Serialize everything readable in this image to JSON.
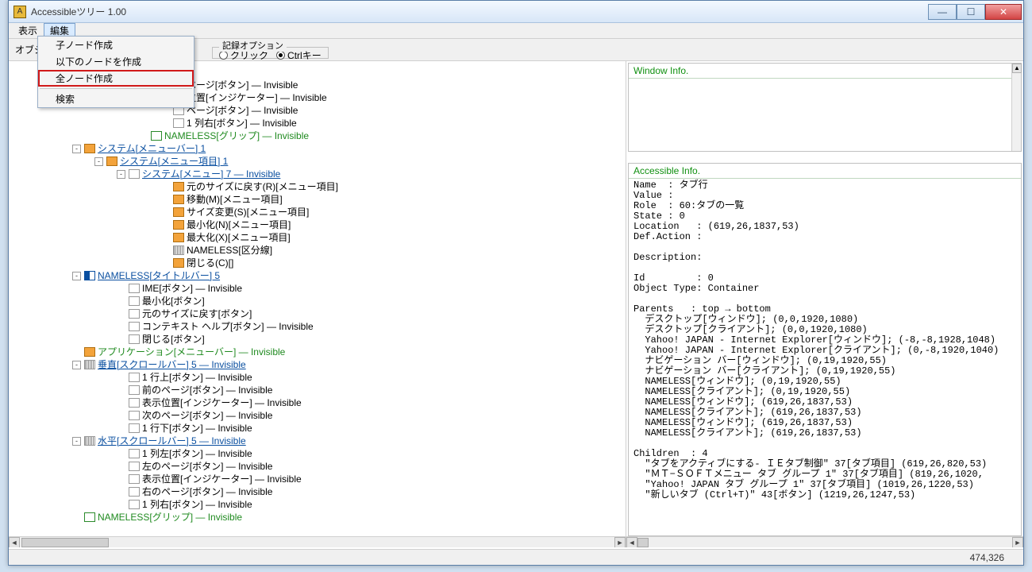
{
  "title": "Accessibleツリー 1.00",
  "menubar": {
    "view": "表示",
    "edit": "編集"
  },
  "toolbar": {
    "obj_label_prefix": "オブジ",
    "legend": "記録オプション",
    "radio_click": "クリック",
    "radio_ctrl": "Ctrlキー"
  },
  "dropdown": {
    "item_child": "子ノード作成",
    "item_below": "以下のノードを作成",
    "item_all": "全ノード作成",
    "item_search": "検索"
  },
  "tree": [
    {
      "d": 13,
      "i": "box",
      "t": "ページ[ボタン] — Invisible",
      "cls": ""
    },
    {
      "d": 13,
      "i": "box",
      "t": "位置[インジケーター] — Invisible",
      "cls": ""
    },
    {
      "d": 13,
      "i": "box",
      "t": "ページ[ボタン] — Invisible",
      "cls": ""
    },
    {
      "d": 13,
      "i": "box",
      "t": "1 列右[ボタン] — Invisible",
      "cls": ""
    },
    {
      "d": 11,
      "i": "green",
      "t": "NAMELESS[グリップ] — Invisible",
      "cls": "lbl-green"
    },
    {
      "d": 5,
      "exp": "-",
      "i": "orange",
      "t": "システム[メニューバー] 1",
      "cls": "lbl-link"
    },
    {
      "d": 7,
      "exp": "-",
      "i": "orange",
      "t": "システム[メニュー項目] 1",
      "cls": "lbl-link"
    },
    {
      "d": 9,
      "exp": "-",
      "i": "",
      "t": "システム[メニュー] 7 — Invisible",
      "cls": "lbl-link"
    },
    {
      "d": 13,
      "i": "orange",
      "t": "元のサイズに戻す(R)[メニュー項目]",
      "cls": ""
    },
    {
      "d": 13,
      "i": "orange",
      "t": "移動(M)[メニュー項目]",
      "cls": ""
    },
    {
      "d": 13,
      "i": "orange",
      "t": "サイズ変更(S)[メニュー項目]",
      "cls": ""
    },
    {
      "d": 13,
      "i": "orange",
      "t": "最小化(N)[メニュー項目]",
      "cls": ""
    },
    {
      "d": 13,
      "i": "orange",
      "t": "最大化(X)[メニュー項目]",
      "cls": ""
    },
    {
      "d": 13,
      "i": "bar",
      "t": "NAMELESS[区分線]",
      "cls": ""
    },
    {
      "d": 13,
      "i": "orange",
      "t": "閉じる(C)[]",
      "cls": ""
    },
    {
      "d": 5,
      "exp": "-",
      "i": "flag",
      "t": "NAMELESS[タイトルバー] 5",
      "cls": "lbl-link"
    },
    {
      "d": 9,
      "i": "box",
      "t": "IME[ボタン] — Invisible",
      "cls": ""
    },
    {
      "d": 9,
      "i": "box",
      "t": "最小化[ボタン]",
      "cls": ""
    },
    {
      "d": 9,
      "i": "box",
      "t": "元のサイズに戻す[ボタン]",
      "cls": ""
    },
    {
      "d": 9,
      "i": "box",
      "t": "コンテキスト ヘルプ[ボタン] — Invisible",
      "cls": ""
    },
    {
      "d": 9,
      "i": "box",
      "t": "閉じる[ボタン]",
      "cls": ""
    },
    {
      "d": 5,
      "i": "orange",
      "t": "アプリケーション[メニューバー] — Invisible",
      "cls": "lbl-green"
    },
    {
      "d": 5,
      "exp": "-",
      "i": "bar",
      "t": "垂直[スクロールバー] 5 — Invisible",
      "cls": "lbl-link"
    },
    {
      "d": 9,
      "i": "box",
      "t": "1 行上[ボタン] — Invisible",
      "cls": ""
    },
    {
      "d": 9,
      "i": "box",
      "t": "前のページ[ボタン] — Invisible",
      "cls": ""
    },
    {
      "d": 9,
      "i": "box",
      "t": "表示位置[インジケーター] — Invisible",
      "cls": ""
    },
    {
      "d": 9,
      "i": "box",
      "t": "次のページ[ボタン] — Invisible",
      "cls": ""
    },
    {
      "d": 9,
      "i": "box",
      "t": "1 行下[ボタン] — Invisible",
      "cls": ""
    },
    {
      "d": 5,
      "exp": "-",
      "i": "bar",
      "t": "水平[スクロールバー] 5 — Invisible",
      "cls": "lbl-link"
    },
    {
      "d": 9,
      "i": "box",
      "t": "1 列左[ボタン] — Invisible",
      "cls": ""
    },
    {
      "d": 9,
      "i": "box",
      "t": "左のページ[ボタン] — Invisible",
      "cls": ""
    },
    {
      "d": 9,
      "i": "box",
      "t": "表示位置[インジケーター] — Invisible",
      "cls": ""
    },
    {
      "d": 9,
      "i": "box",
      "t": "右のページ[ボタン] — Invisible",
      "cls": ""
    },
    {
      "d": 9,
      "i": "box",
      "t": "1 列右[ボタン] — Invisible",
      "cls": ""
    },
    {
      "d": 5,
      "i": "green",
      "t": "NAMELESS[グリップ] — Invisible",
      "cls": "lbl-green"
    }
  ],
  "right": {
    "winfo_hdr": "Window Info.",
    "ainfo_hdr": "Accessible Info.",
    "ainfo_text": "Name  : タブ行\nValue :\nRole  : 60:タブの一覧\nState : 0\nLocation   : (619,26,1837,53)\nDef.Action :\n\nDescription:\n\nId         : 0\nObject Type: Container\n\nParents   : top → bottom\n  デスクトップ[ウィンドウ]; (0,0,1920,1080)\n  デスクトップ[クライアント]; (0,0,1920,1080)\n  Yahoo! JAPAN - Internet Explorer[ウィンドウ]; (-8,-8,1928,1048)\n  Yahoo! JAPAN - Internet Explorer[クライアント]; (0,-8,1920,1040)\n  ナビゲーション バー[ウィンドウ]; (0,19,1920,55)\n  ナビゲーション バー[クライアント]; (0,19,1920,55)\n  NAMELESS[ウィンドウ]; (0,19,1920,55)\n  NAMELESS[クライアント]; (0,19,1920,55)\n  NAMELESS[ウィンドウ]; (619,26,1837,53)\n  NAMELESS[クライアント]; (619,26,1837,53)\n  NAMELESS[ウィンドウ]; (619,26,1837,53)\n  NAMELESS[クライアント]; (619,26,1837,53)\n\nChildren  : 4\n  \"タブをアクティブにする- ＩＥタブ制御\" 37[タブ項目] (619,26,820,53)\n  \"ＭＴ−ＳＯＦＴメニュー タブ グループ 1\" 37[タブ項目] (819,26,1020,\n  \"Yahoo! JAPAN タブ グループ 1\" 37[タブ項目] (1019,26,1220,53)\n  \"新しいタブ (Ctrl+T)\" 43[ボタン] (1219,26,1247,53)"
  },
  "status": "474,326"
}
